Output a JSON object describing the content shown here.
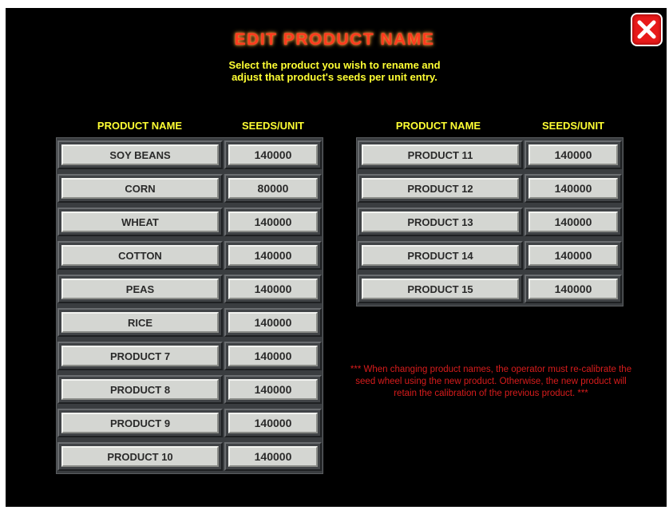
{
  "title": "EDIT PRODUCT NAME",
  "subtitle_line1": "Select the product you wish to rename and",
  "subtitle_line2": "adjust that product's seeds per unit entry.",
  "close_icon": "close-x-icon",
  "colors": {
    "background": "#000000",
    "title": "#ff3b1f",
    "header": "#ffff33",
    "note": "#d81c1c",
    "close": "#e81a1a"
  },
  "left_table": {
    "header_name": "PRODUCT NAME",
    "header_seeds": "SEEDS/UNIT",
    "rows": [
      {
        "name": "SOY BEANS",
        "seeds": "140000"
      },
      {
        "name": "CORN",
        "seeds": "80000"
      },
      {
        "name": "WHEAT",
        "seeds": "140000"
      },
      {
        "name": "COTTON",
        "seeds": "140000"
      },
      {
        "name": "PEAS",
        "seeds": "140000"
      },
      {
        "name": "RICE",
        "seeds": "140000"
      },
      {
        "name": "PRODUCT 7",
        "seeds": "140000"
      },
      {
        "name": "PRODUCT 8",
        "seeds": "140000"
      },
      {
        "name": "PRODUCT 9",
        "seeds": "140000"
      },
      {
        "name": "PRODUCT 10",
        "seeds": "140000"
      }
    ]
  },
  "right_table": {
    "header_name": "PRODUCT NAME",
    "header_seeds": "SEEDS/UNIT",
    "rows": [
      {
        "name": "PRODUCT 11",
        "seeds": "140000"
      },
      {
        "name": "PRODUCT 12",
        "seeds": "140000"
      },
      {
        "name": "PRODUCT 13",
        "seeds": "140000"
      },
      {
        "name": "PRODUCT 14",
        "seeds": "140000"
      },
      {
        "name": "PRODUCT 15",
        "seeds": "140000"
      }
    ]
  },
  "note": "*** When changing product names, the operator must re-calibrate the seed wheel using the new product. Otherwise, the new product will retain the calibration of the previous product. ***"
}
